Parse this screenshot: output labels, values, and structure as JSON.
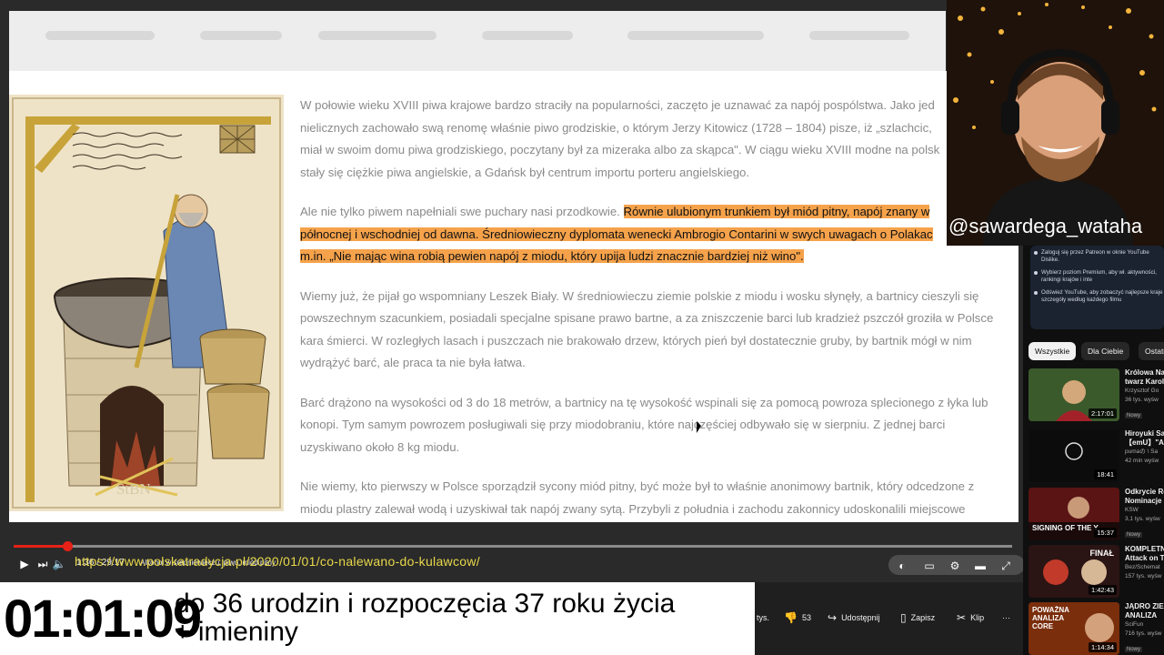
{
  "article": {
    "paragraphs": [
      {
        "lines": [
          "W połowie wieku XVIII piwa krajowe bardzo straciły na popularności, zaczęto je uznawać za napój pospólstwa. Jako jed",
          "nielicznych zachowało swą renomę właśnie piwo grodziskie, o którym Jerzy Kitowicz (1728 – 1804) pisze, iż „szlachcic,",
          "miał w swoim domu piwa grodziskiego, poczytany był za mizeraka albo za skąpca\". W ciągu wieku XVIII modne na polsk",
          "stały się ciężkie piwa angielskie, a Gdańsk był centrum importu porteru angielskiego."
        ]
      },
      {
        "lead": "Ale nie tylko piwem napełniali swe puchary nasi przodkowie. ",
        "highlight_lines": [
          "Równie ulubionym trunkiem był miód pitny, napój znany w",
          "północnej i wschodniej od dawna. Średniowieczny dyplomata wenecki Ambrogio Contarini w swych uwagach o Polakac",
          "m.in. „Nie mając wina robią pewien napój z miodu, który upija ludzi znacznie bardziej niż wino\"."
        ]
      },
      {
        "lines": [
          "Wiemy już, że pijał go wspomniany Leszek Biały. W średniowieczu ziemie polskie z miodu i wosku słynęły, a bartnicy cieszyli się",
          "powszechnym szacunkiem, posiadali specjalne spisane prawo bartne, a za zniszczenie barci lub kradzież pszczół groziła w Polsce",
          "kara śmierci. W rozległych lasach i puszczach nie brakowało drzew, których pień był dostatecznie gruby, by bartnik mógł w nim",
          "wydrążyć barć, ale praca ta nie była łatwa."
        ]
      },
      {
        "lines": [
          "Barć drążono na wysokości od 3 do 18 metrów, a bartnicy na tę wysokość wspinali się za pomocą powroza splecionego z łyka lub",
          "konopi. Tym samym powrozem posługiwali się przy miodobraniu, które najczęściej odbywało się w sierpniu. Z jednej barci",
          "uzyskiwano około 8 kg miodu."
        ]
      },
      {
        "lines": [
          "Nie wiemy, kto pierwszy w Polsce sporządził sycony miód pitny, być może był to właśnie anonimowy bartnik, który odcedzone z",
          "miodu plastry zalewał wodą i uzyskiwał tak napój zwany sytą. Przybyli z południa i zachodu zakonnicy udoskonalili miejscowe"
        ]
      }
    ],
    "image_watermark": "StBN"
  },
  "player": {
    "time": "1:36 / 29:17",
    "chapter": "Alkohol w średniowieczu, piwo, miód pitny",
    "url_overlay": "https://www.polskatradycja.pl/2020/01/01/co-nalewano-do-kulawcow/",
    "progress": 0.05
  },
  "actions": {
    "dislike_count": "53",
    "like_suffix": "tys.",
    "share": "Udostępnij",
    "save": "Zapisz",
    "clip": "Klip",
    "more": "···"
  },
  "sidebar": {
    "info": [
      "Zaloguj się przez Patreon w oknie YouTube Dislike.",
      "Wybierz poziom Premium, aby wł. aktywności, rankingi krajów i inte",
      "Odśwież YouTube, aby zobaczyć najlepsze kraje i szczegóły według każdego filmu"
    ],
    "chips": [
      "Wszystkie",
      "Dla Ciebie",
      "Ostatni"
    ],
    "videos": [
      {
        "title": "Królowa Na",
        "title2": "twarz Karol",
        "channel": "Krzysztof Go",
        "views": "36 tys. wyśw",
        "duration": "2:17:01",
        "new": "Nowy",
        "color": "#4a3b2a"
      },
      {
        "title": "Hiroyuki Sa",
        "title2": "【emU】\"A",
        "channel": "pumaの \\ Sa",
        "views": "42 min wyśw",
        "duration": "18:41",
        "new": "",
        "color": "#111111"
      },
      {
        "title": "Odkrycie Ro",
        "title2": "Nominacje",
        "channel": "KSW",
        "views": "3,1 tys. wyśw",
        "duration": "15:37",
        "new": "Nowy",
        "color": "#5a1a1a",
        "thumb_text": "SIGNING OF THE Y"
      },
      {
        "title": "KOMPLETN",
        "title2": "Attack on T",
        "channel": "Bez/Schemat",
        "views": "157 tys. wyśw",
        "duration": "1:42:43",
        "new": "",
        "color": "#2a1010",
        "thumb_text": "FINAŁ"
      },
      {
        "title": "JĄDRO ZIE",
        "title2": "ANALIZA",
        "channel": "SciFun",
        "views": "716 tys. wyśw",
        "duration": "1:14:34",
        "new": "Nowy",
        "color": "#8a3a10",
        "thumb_text": "POWAŻNA ANALIZA CORE"
      }
    ]
  },
  "stream": {
    "handle": "@sawardega_wataha",
    "timer": "01:01:09",
    "caption_line1": "do 36 urodzin i rozpoczęcia 37 roku życia",
    "caption_line2": "+ imieniny"
  }
}
